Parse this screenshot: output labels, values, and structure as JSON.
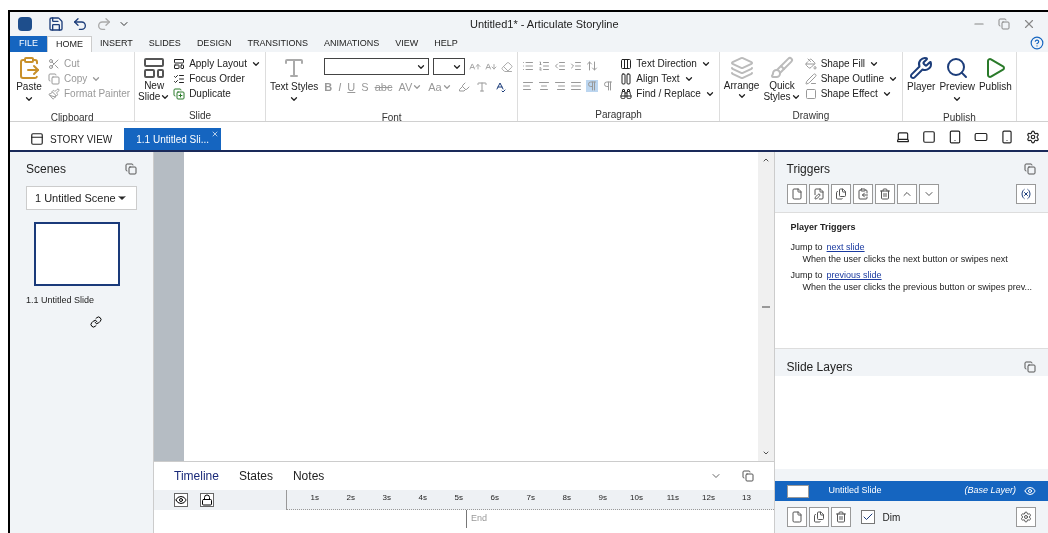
{
  "window": {
    "title": "Untitled1* - Articulate Storyline"
  },
  "menu_tabs": [
    {
      "label": "FILE",
      "kind": "file",
      "selected": false
    },
    {
      "label": "HOME",
      "kind": "tab",
      "selected": true
    },
    {
      "label": "INSERT",
      "kind": "tab",
      "selected": false
    },
    {
      "label": "SLIDES",
      "kind": "tab",
      "selected": false
    },
    {
      "label": "DESIGN",
      "kind": "tab",
      "selected": false
    },
    {
      "label": "TRANSITIONS",
      "kind": "tab",
      "selected": false
    },
    {
      "label": "ANIMATIONS",
      "kind": "tab",
      "selected": false
    },
    {
      "label": "VIEW",
      "kind": "tab",
      "selected": false
    },
    {
      "label": "HELP",
      "kind": "tab",
      "selected": false
    }
  ],
  "ribbon": {
    "clipboard": {
      "label": "Clipboard",
      "paste": "Paste",
      "items": [
        {
          "label": "Cut",
          "menu": false,
          "disabled": true
        },
        {
          "label": "Copy",
          "menu": true,
          "disabled": true
        },
        {
          "label": "Format Painter",
          "menu": false,
          "disabled": true
        }
      ]
    },
    "slide": {
      "label": "Slide",
      "new_slide": [
        "New",
        "Slide"
      ],
      "items": [
        {
          "label": "Apply Layout",
          "menu": true
        },
        {
          "label": "Focus Order",
          "menu": false
        },
        {
          "label": "Duplicate",
          "menu": false
        }
      ]
    },
    "font": {
      "label": "Font",
      "text_styles": "Text Styles",
      "format_buttons": [
        {
          "label": "B",
          "menu": false
        },
        {
          "label": "I",
          "menu": false
        },
        {
          "label": "U",
          "menu": false
        },
        {
          "label": "S",
          "menu": false
        },
        {
          "label": "abc",
          "menu": false
        },
        {
          "label": "AV",
          "menu": true
        },
        {
          "label": "Aa",
          "menu": true
        }
      ]
    },
    "paragraph": {
      "label": "Paragraph",
      "items": [
        {
          "label": "Text Direction",
          "menu": true
        },
        {
          "label": "Align Text",
          "menu": true
        },
        {
          "label": "Find / Replace",
          "menu": true
        }
      ]
    },
    "drawing": {
      "label": "Drawing",
      "arrange": "Arrange",
      "quick_styles": [
        "Quick",
        "Styles"
      ],
      "items": [
        {
          "label": "Shape Fill",
          "menu": true
        },
        {
          "label": "Shape Outline",
          "menu": true
        },
        {
          "label": "Shape Effect",
          "menu": true
        }
      ]
    },
    "publish": {
      "label": "Publish",
      "items": [
        {
          "label": "Player",
          "menu": false
        },
        {
          "label": "Preview",
          "menu": true
        },
        {
          "label": "Publish",
          "menu": false
        }
      ]
    }
  },
  "view_tabs": [
    {
      "label": "STORY VIEW",
      "selected": false
    },
    {
      "label": "1.1 Untitled Sli...",
      "selected": true
    }
  ],
  "scenes": {
    "title": "Scenes",
    "scene_select": "1 Untitled Scene",
    "slides": [
      {
        "label": "1.1 Untitled Slide",
        "selected": true
      }
    ]
  },
  "timeline": {
    "tabs": [
      {
        "label": "Timeline",
        "selected": true
      },
      {
        "label": "States",
        "selected": false
      },
      {
        "label": "Notes",
        "selected": false
      }
    ],
    "ticks": [
      "1s",
      "2s",
      "3s",
      "4s",
      "5s",
      "6s",
      "7s",
      "8s",
      "9s",
      "10s",
      "11s",
      "12s",
      "13"
    ],
    "end_label": "End"
  },
  "triggers": {
    "title": "Triggers",
    "section": "Player Triggers",
    "items": [
      {
        "action": "Jump to",
        "target": "next slide",
        "condition": "When the user clicks the next button or swipes next"
      },
      {
        "action": "Jump to",
        "target": "previous slide",
        "condition": "When the user clicks the previous button or swipes prev..."
      }
    ]
  },
  "slide_layers": {
    "title": "Slide Layers",
    "layers": [
      {
        "name": "Untitled Slide",
        "note": "(Base Layer)",
        "selected": true
      }
    ],
    "dim": {
      "label": "Dim",
      "checked": true
    }
  }
}
